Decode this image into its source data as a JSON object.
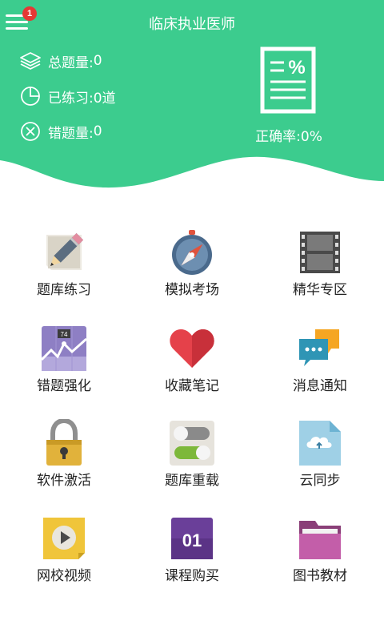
{
  "header": {
    "title": "临床执业医师",
    "notification_count": "1",
    "stats": {
      "total_label": "总题量:",
      "total_value": "0",
      "practiced_label": "已练习:",
      "practiced_value": "0道",
      "wrong_label": "错题量:",
      "wrong_value": "0"
    },
    "accuracy_label": "正确率:",
    "accuracy_value": "0%",
    "accent_color": "#3ccc8e"
  },
  "menu": [
    {
      "label": "题库练习",
      "icon": "pencil-paper-icon"
    },
    {
      "label": "模拟考场",
      "icon": "compass-icon"
    },
    {
      "label": "精华专区",
      "icon": "film-strip-icon"
    },
    {
      "label": "错题强化",
      "icon": "line-chart-icon",
      "badge_text": "74"
    },
    {
      "label": "收藏笔记",
      "icon": "heart-icon"
    },
    {
      "label": "消息通知",
      "icon": "chat-bubbles-icon"
    },
    {
      "label": "软件激活",
      "icon": "padlock-icon"
    },
    {
      "label": "题库重载",
      "icon": "toggle-switches-icon"
    },
    {
      "label": "云同步",
      "icon": "cloud-upload-icon"
    },
    {
      "label": "网校视频",
      "icon": "play-video-icon"
    },
    {
      "label": "课程购买",
      "icon": "calendar-icon",
      "calendar_text": "01"
    },
    {
      "label": "图书教材",
      "icon": "folder-icon"
    }
  ]
}
